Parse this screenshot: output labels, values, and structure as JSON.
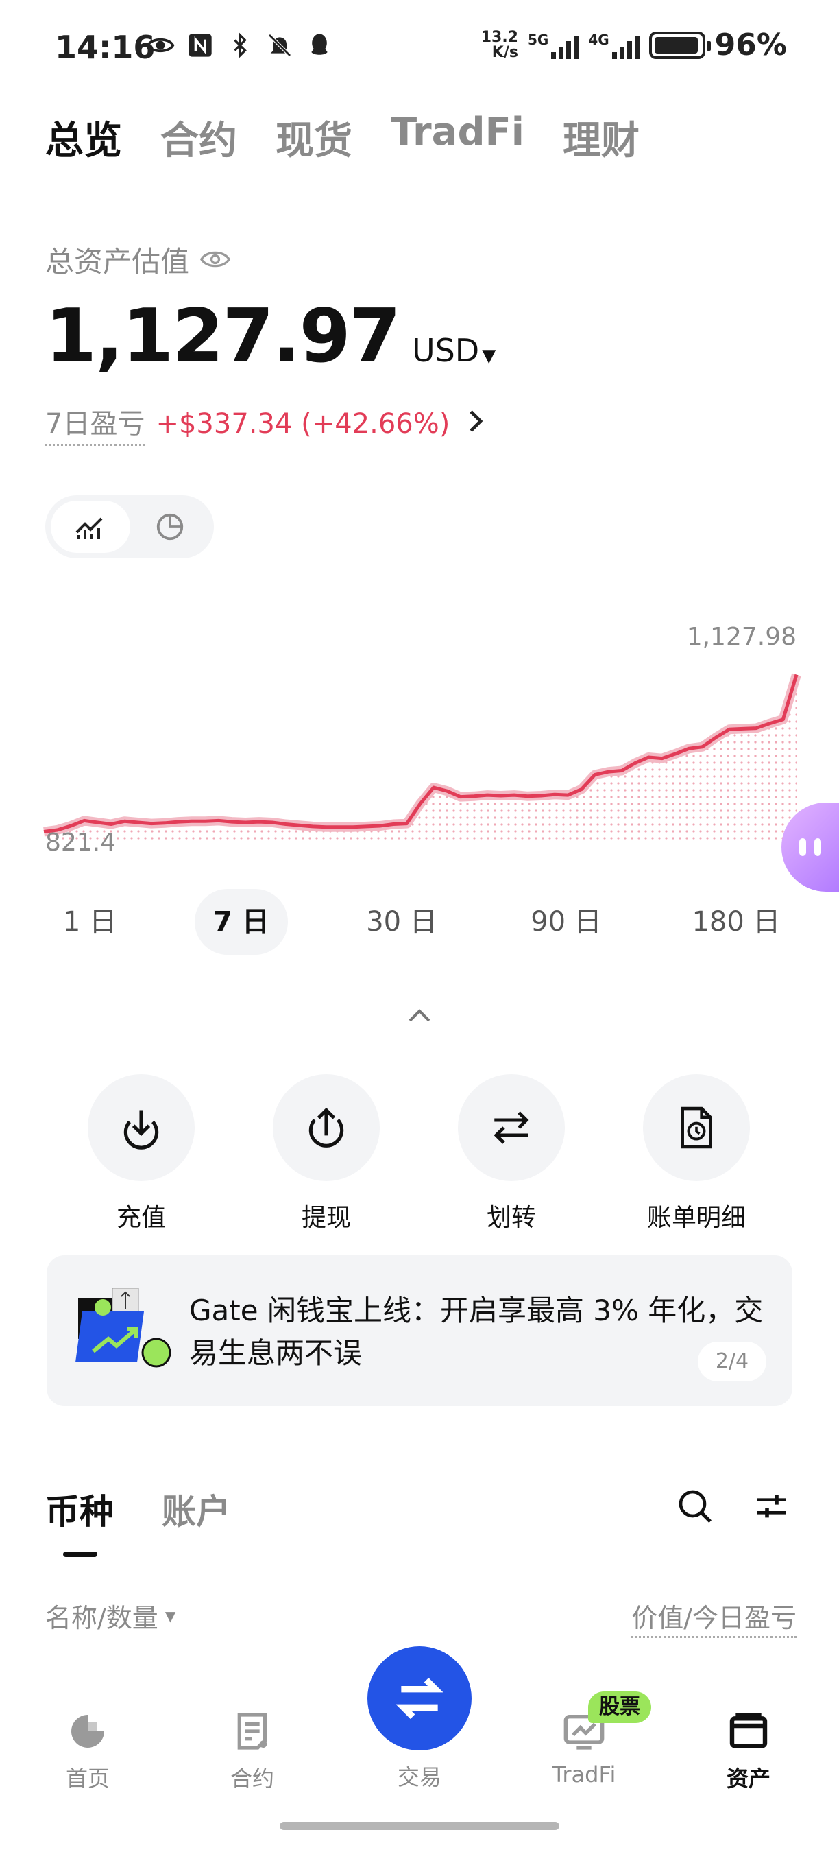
{
  "status": {
    "time": "14:16",
    "net_speed_value": "13.2",
    "net_speed_unit": "K/s",
    "sig1_label": "5G",
    "sig2_label": "4G",
    "battery_pct": "96%",
    "battery_level": 0.96
  },
  "top_tabs": [
    {
      "label": "总览",
      "active": true
    },
    {
      "label": "合约"
    },
    {
      "label": "现货"
    },
    {
      "label": "TradFi"
    },
    {
      "label": "理财"
    }
  ],
  "asset": {
    "label": "总资产估值",
    "value": "1,127.97",
    "currency": "USD",
    "pnl_label": "7日盈亏",
    "pnl_value": "+$337.34 (+42.66%)"
  },
  "chart_data": {
    "type": "line",
    "max_label": "1,127.98",
    "min_label": "821.4",
    "ylim": [
      821.4,
      1127.98
    ],
    "values": [
      842,
      845,
      852,
      861,
      858,
      855,
      860,
      858,
      856,
      857,
      859,
      860,
      860,
      861,
      859,
      858,
      859,
      858,
      855,
      853,
      851,
      850,
      850,
      850,
      851,
      852,
      855,
      856,
      890,
      918,
      912,
      902,
      903,
      905,
      904,
      905,
      903,
      904,
      906,
      905,
      915,
      940,
      945,
      947,
      960,
      970,
      968,
      976,
      985,
      988,
      1004,
      1018,
      1019,
      1020,
      1028,
      1035,
      1112
    ],
    "color": "#e23c57",
    "grid": false
  },
  "range_tabs": [
    {
      "label": "1 日"
    },
    {
      "label": "7 日",
      "active": true
    },
    {
      "label": "30 日"
    },
    {
      "label": "90 日"
    },
    {
      "label": "180 日"
    }
  ],
  "actions": [
    {
      "label": "充值",
      "icon": "deposit-icon"
    },
    {
      "label": "提现",
      "icon": "withdraw-icon"
    },
    {
      "label": "划转",
      "icon": "transfer-icon"
    },
    {
      "label": "账单明细",
      "icon": "bill-icon"
    }
  ],
  "banner": {
    "text": "Gate 闲钱宝上线：开启享最高 3% 年化，交易生息两不误",
    "page": "2/4"
  },
  "list_tabs": [
    {
      "label": "币种",
      "active": true
    },
    {
      "label": "账户"
    }
  ],
  "columns": {
    "left": "名称/数量",
    "right": "价值/今日盈亏"
  },
  "bottom_nav": {
    "home": "首页",
    "futures": "合约",
    "trade": "交易",
    "tradfi": "TradFi",
    "tradfi_badge": "股票",
    "assets": "资产"
  },
  "colors": {
    "accent": "#2354e6",
    "loss_gain": "#e23c57",
    "badge": "#9be55b"
  }
}
